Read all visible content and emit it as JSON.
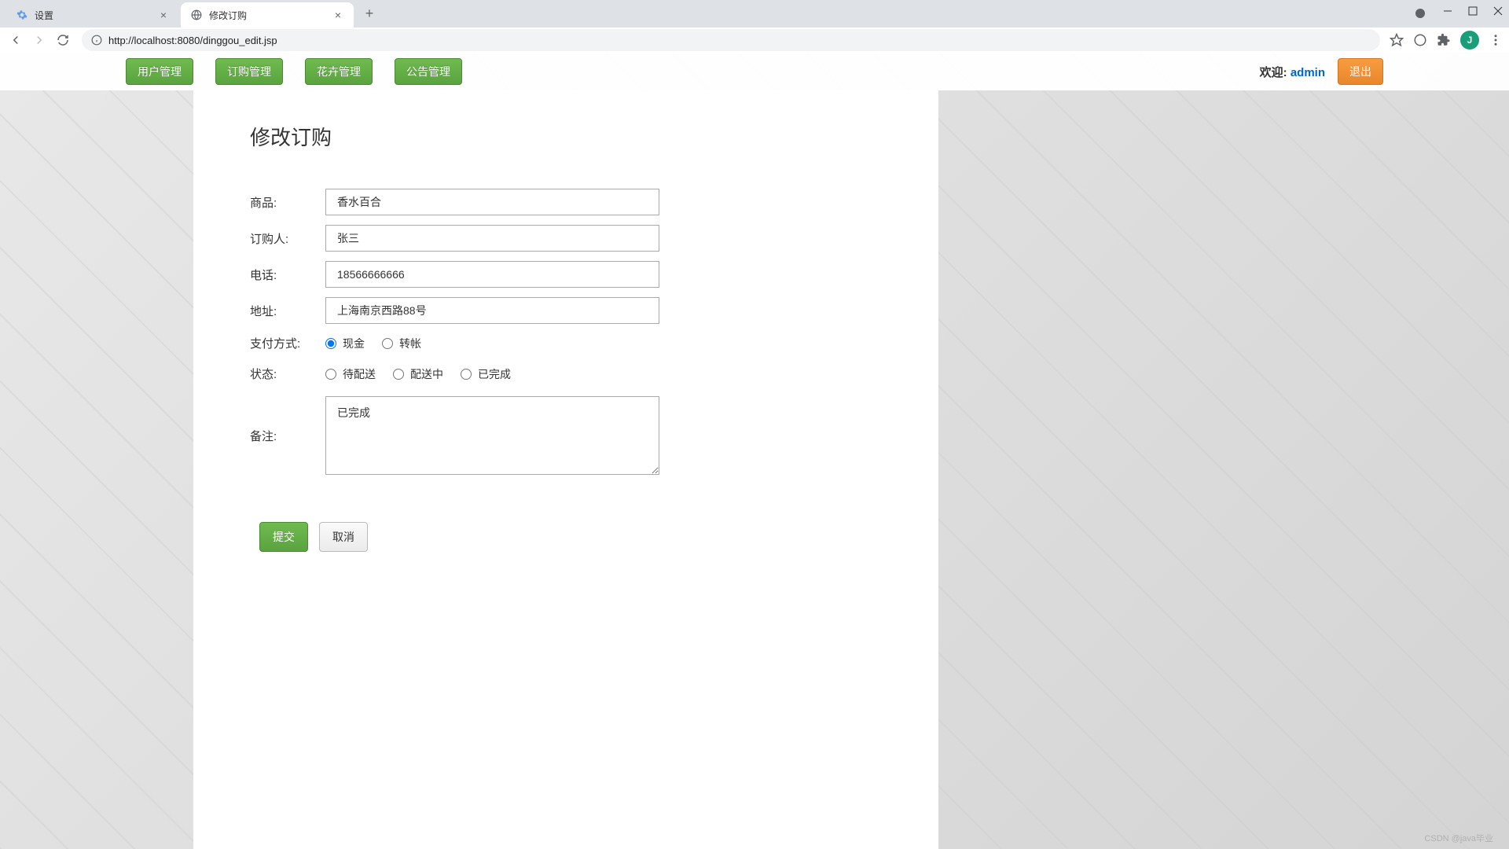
{
  "browser": {
    "tabs": [
      {
        "title": "设置",
        "active": false
      },
      {
        "title": "修改订购",
        "active": true
      }
    ],
    "url_display": "http://localhost:8080/dinggou_edit.jsp",
    "url_host": "localhost",
    "profile_letter": "J"
  },
  "top_nav": {
    "buttons": [
      "用户管理",
      "订购管理",
      "花卉管理",
      "公告管理"
    ],
    "welcome_label": "欢迎:",
    "welcome_user": "admin",
    "logout": "退出"
  },
  "page": {
    "title": "修改订购"
  },
  "form": {
    "product_label": "商品:",
    "product_value": "香水百合",
    "buyer_label": "订购人:",
    "buyer_value": "张三",
    "phone_label": "电话:",
    "phone_value": "18566666666",
    "address_label": "地址:",
    "address_value": "上海南京西路88号",
    "payment_label": "支付方式:",
    "payment_options": [
      "现金",
      "转帐"
    ],
    "payment_selected": "现金",
    "status_label": "状态:",
    "status_options": [
      "待配送",
      "配送中",
      "已完成"
    ],
    "remark_label": "备注:",
    "remark_value": "已完成",
    "submit": "提交",
    "cancel": "取消"
  },
  "watermark": "CSDN @java毕业"
}
